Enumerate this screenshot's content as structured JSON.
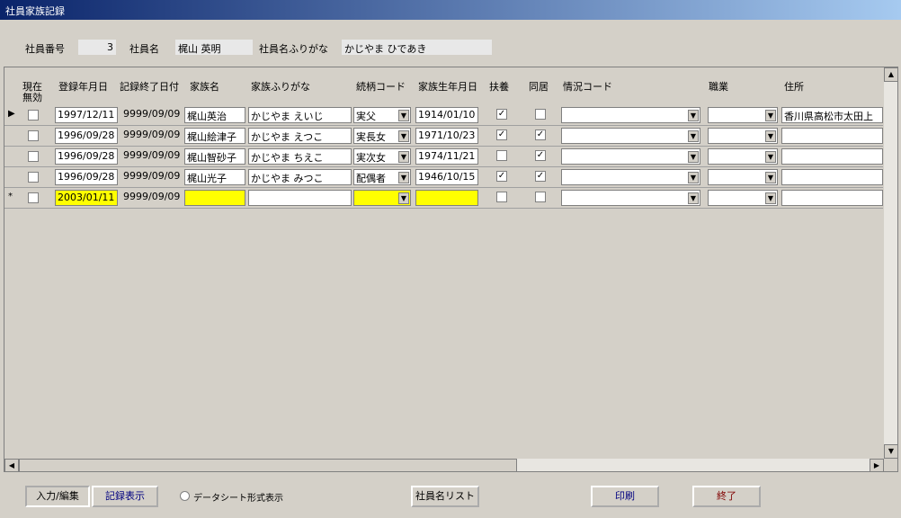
{
  "window": {
    "title": "社員家族記録"
  },
  "header": {
    "emp_no_label": "社員番号",
    "emp_no_value": "3",
    "emp_name_label": "社員名",
    "emp_name_value": "梶山 英明",
    "emp_kana_label": "社員名ふりがな",
    "emp_kana_value": "かじやま ひであき"
  },
  "columns": {
    "c0": "現在",
    "c0b": "無効",
    "c1": "登録年月日",
    "c2": "記録終了日付",
    "c3": "家族名",
    "c4": "家族ふりがな",
    "c5": "続柄コード",
    "c6": "家族生年月日",
    "c7": "扶養",
    "c8": "同居",
    "c9": "情況コード",
    "c10": "職業",
    "c11": "住所"
  },
  "rows": [
    {
      "selector": "▶",
      "reg": "1997/12/11",
      "end": "9999/09/09",
      "name": "梶山英治",
      "kana": "かじやま えいじ",
      "rel": "実父",
      "birth": "1914/01/10",
      "fuyo": "✓",
      "dokyo": "",
      "addr": "香川県高松市太田上"
    },
    {
      "selector": "",
      "reg": "1996/09/28",
      "end": "9999/09/09",
      "name": "梶山絵津子",
      "kana": "かじやま えつこ",
      "rel": "実長女",
      "birth": "1971/10/23",
      "fuyo": "✓",
      "dokyo": "✓",
      "addr": ""
    },
    {
      "selector": "",
      "reg": "1996/09/28",
      "end": "9999/09/09",
      "name": "梶山智砂子",
      "kana": "かじやま ちえこ",
      "rel": "実次女",
      "birth": "1974/11/21",
      "fuyo": "",
      "dokyo": "✓",
      "addr": ""
    },
    {
      "selector": "",
      "reg": "1996/09/28",
      "end": "9999/09/09",
      "name": "梶山光子",
      "kana": "かじやま みつこ",
      "rel": "配偶者",
      "birth": "1946/10/15",
      "fuyo": "✓",
      "dokyo": "✓",
      "addr": ""
    },
    {
      "selector": "*",
      "reg": "2003/01/11",
      "end": "9999/09/09",
      "name": "",
      "kana": "",
      "rel": "",
      "birth": "",
      "fuyo": "",
      "dokyo": "",
      "addr": ""
    }
  ],
  "footer": {
    "input_edit": "入力/編集",
    "record_view": "記録表示",
    "datasheet": "データシート形式表示",
    "emp_list": "社員名リスト",
    "print": "印刷",
    "exit": "終了"
  },
  "colors": {
    "new_row_highlight": "#ffff00",
    "print_text": "#000080",
    "exit_text": "#800000"
  }
}
